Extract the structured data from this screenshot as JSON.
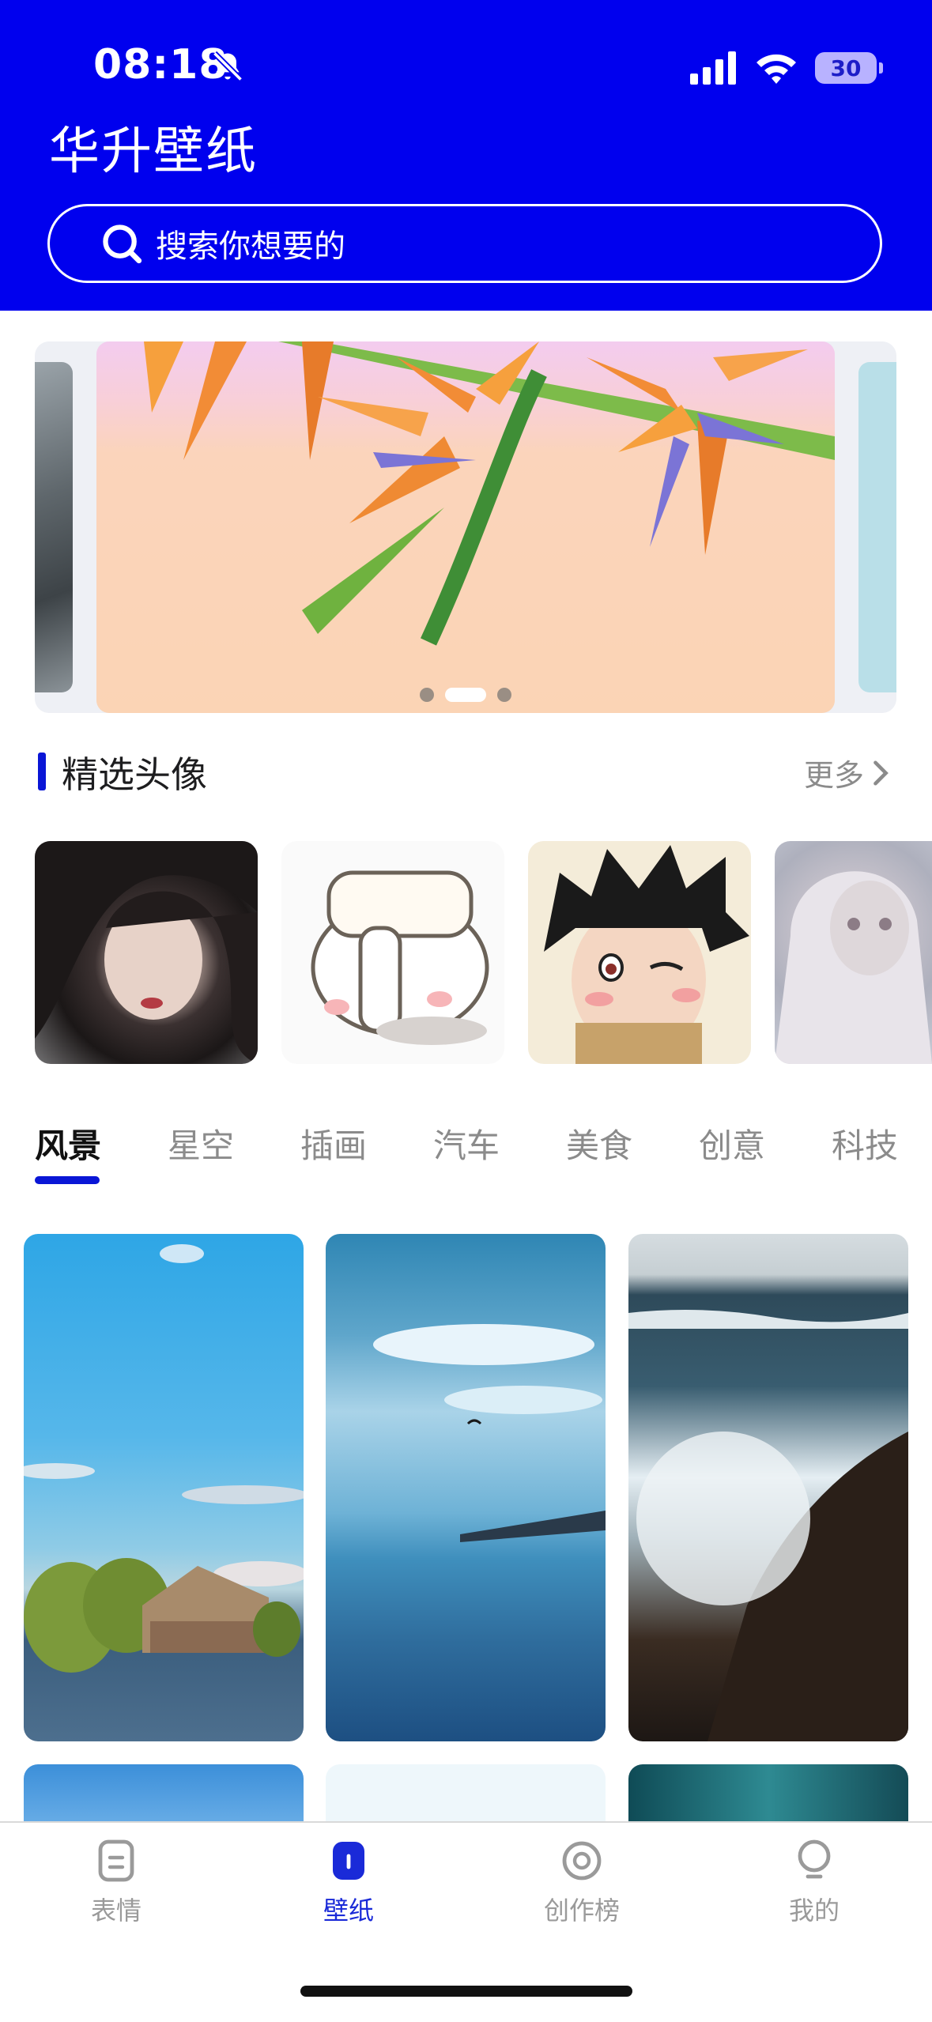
{
  "status_bar": {
    "time": "08:18",
    "battery": "30",
    "icons": [
      "bell-slash-icon",
      "cellular-signal-icon",
      "wifi-icon",
      "battery-icon"
    ]
  },
  "header": {
    "title": "华升壁纸",
    "search_placeholder": "搜索你想要的"
  },
  "banner": {
    "slide_count": 3,
    "active_index": 1
  },
  "featured_avatars": {
    "title": "精选头像",
    "more_label": "更多"
  },
  "categories": {
    "tabs": [
      "风景",
      "星空",
      "插画",
      "汽车",
      "美食",
      "创意",
      "科技"
    ],
    "active_index": 0
  },
  "bottom_nav": {
    "items": [
      "表情",
      "壁纸",
      "创作榜",
      "我的"
    ],
    "active_index": 1
  },
  "colors": {
    "brand": "#0000ee",
    "accent": "#0a16d6"
  }
}
